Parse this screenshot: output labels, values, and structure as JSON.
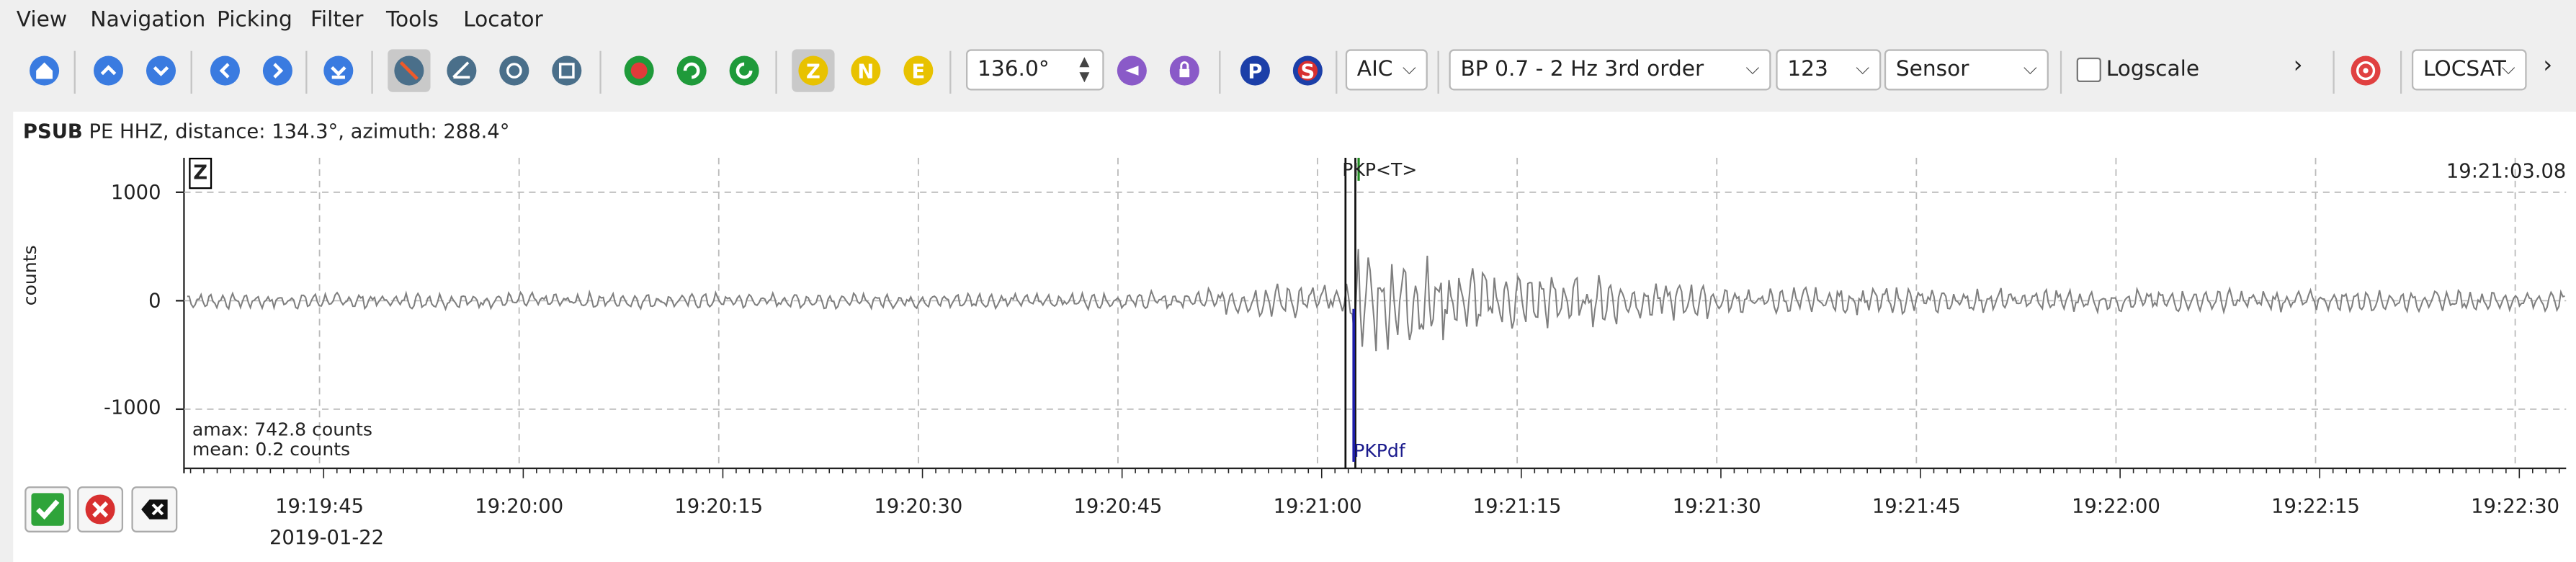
{
  "menu": [
    "View",
    "Navigation",
    "Picking",
    "Filter",
    "Tools",
    "Locator"
  ],
  "toolbar": {
    "angle_value": "136.0°",
    "picker_method": "AIC",
    "filter": "BP 0.7 - 2 Hz  3rd order",
    "channel_combo": "123",
    "unit_combo": "Sensor",
    "logscale_label": "Logscale",
    "locator": "LOCSAT",
    "comp_z": "Z",
    "comp_n": "N",
    "comp_e": "E",
    "pick_p": "P",
    "pick_s": "S"
  },
  "trace": {
    "station": "PSUB",
    "info": "PE  HHZ, distance: 134.3°, azimuth: 288.4°",
    "ylabel": "counts",
    "yticks": [
      "1000",
      "0",
      "-1000"
    ],
    "component": "Z",
    "time_right": "19:21:03.08",
    "phase_top": "PKP<T>",
    "phase_bottom": "PKPdf",
    "amax": "amax: 742.8 counts",
    "mean": "mean: 0.2 counts",
    "xticks": [
      "19:19:45",
      "19:20:00",
      "19:20:15",
      "19:20:30",
      "19:20:45",
      "19:21:00",
      "19:21:15",
      "19:21:30",
      "19:21:45",
      "19:22:00",
      "19:22:15",
      "19:22:30"
    ],
    "date": "2019-01-22"
  },
  "colors": {
    "trace": "#7f7f7f",
    "pick_blue": "#1f1fa8",
    "pick_green": "#1f8a1f",
    "accent_red": "#e04040",
    "accent_yellow": "#e8c200",
    "accent_blue": "#2f6fd6"
  }
}
